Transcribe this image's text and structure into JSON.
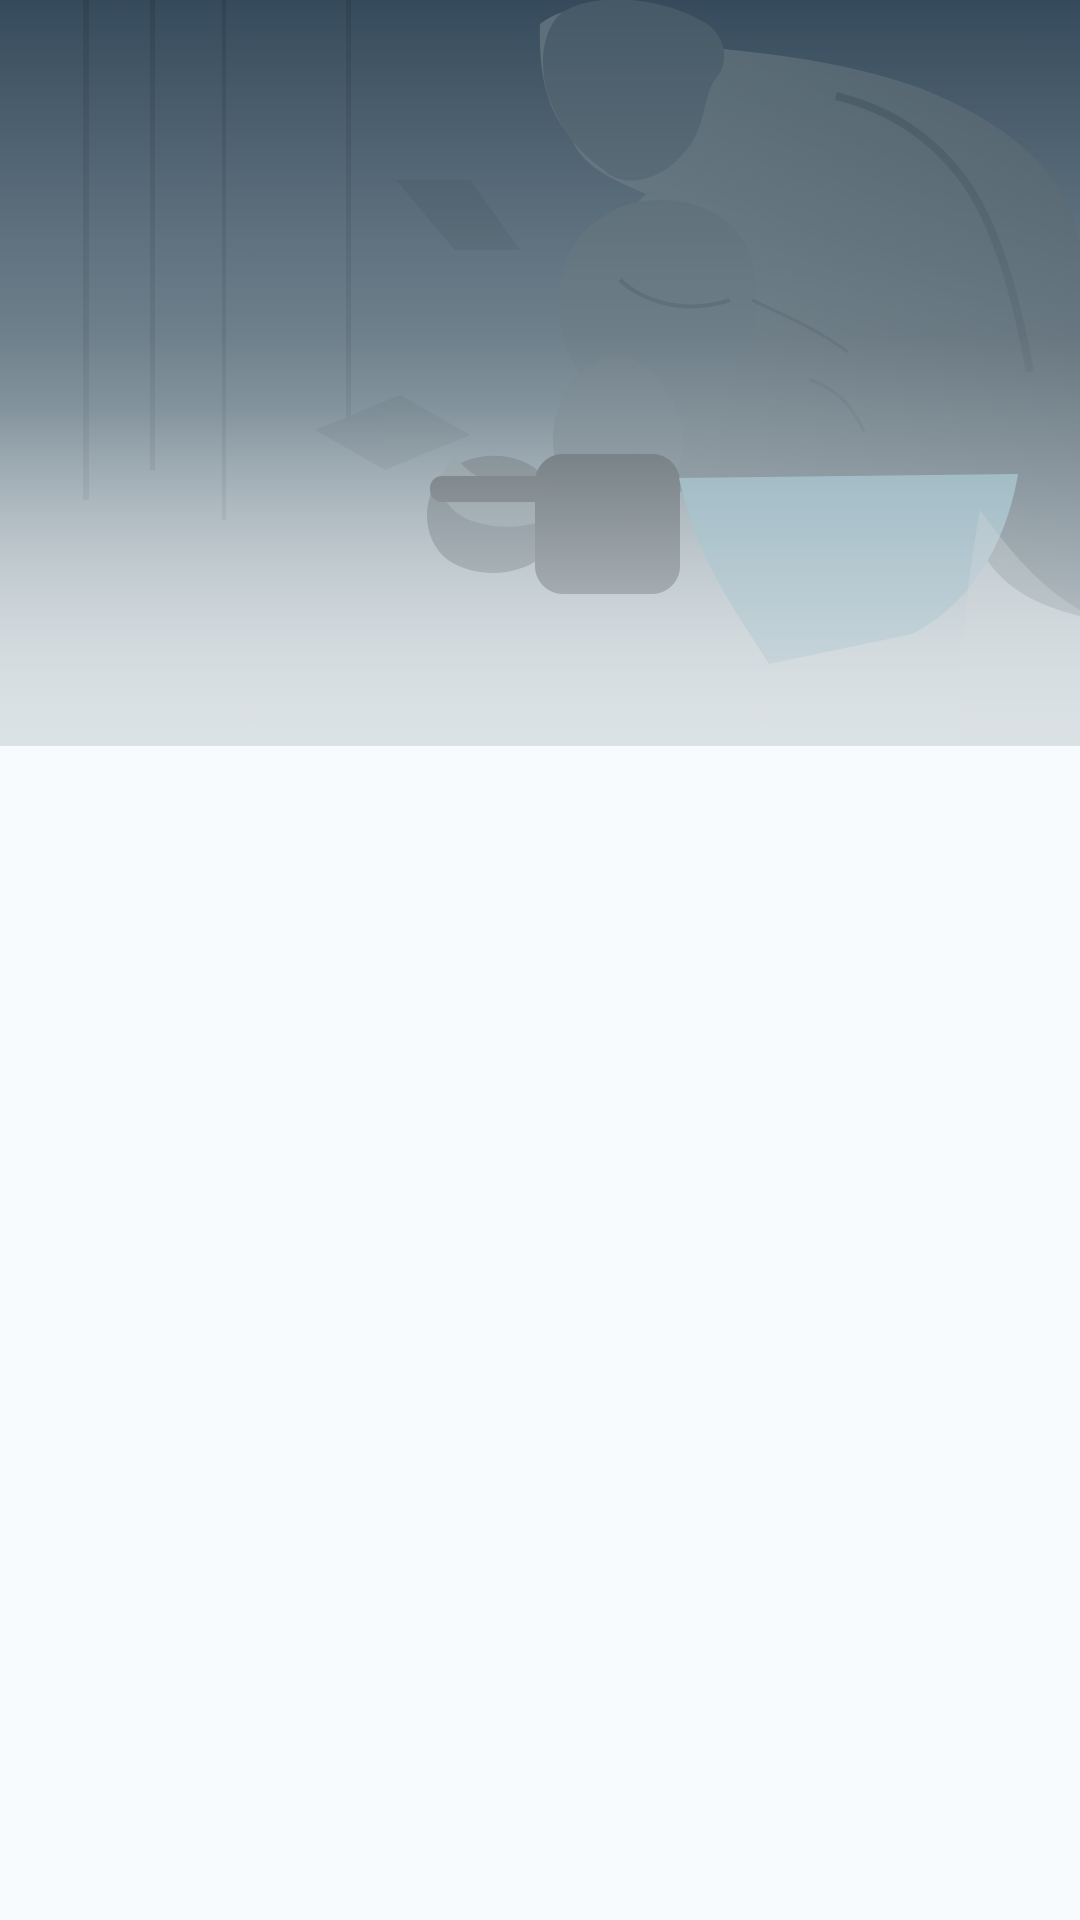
{
  "theme": {
    "page_background": "#f7fbfd",
    "hero_overlay_top": "#3b4f60",
    "hero_overlay_bottom": "#dbe2e5",
    "shorts_color": "#6d99aa"
  },
  "hero": {
    "image_subject": "athlete-dumbbell-curl-photo"
  }
}
